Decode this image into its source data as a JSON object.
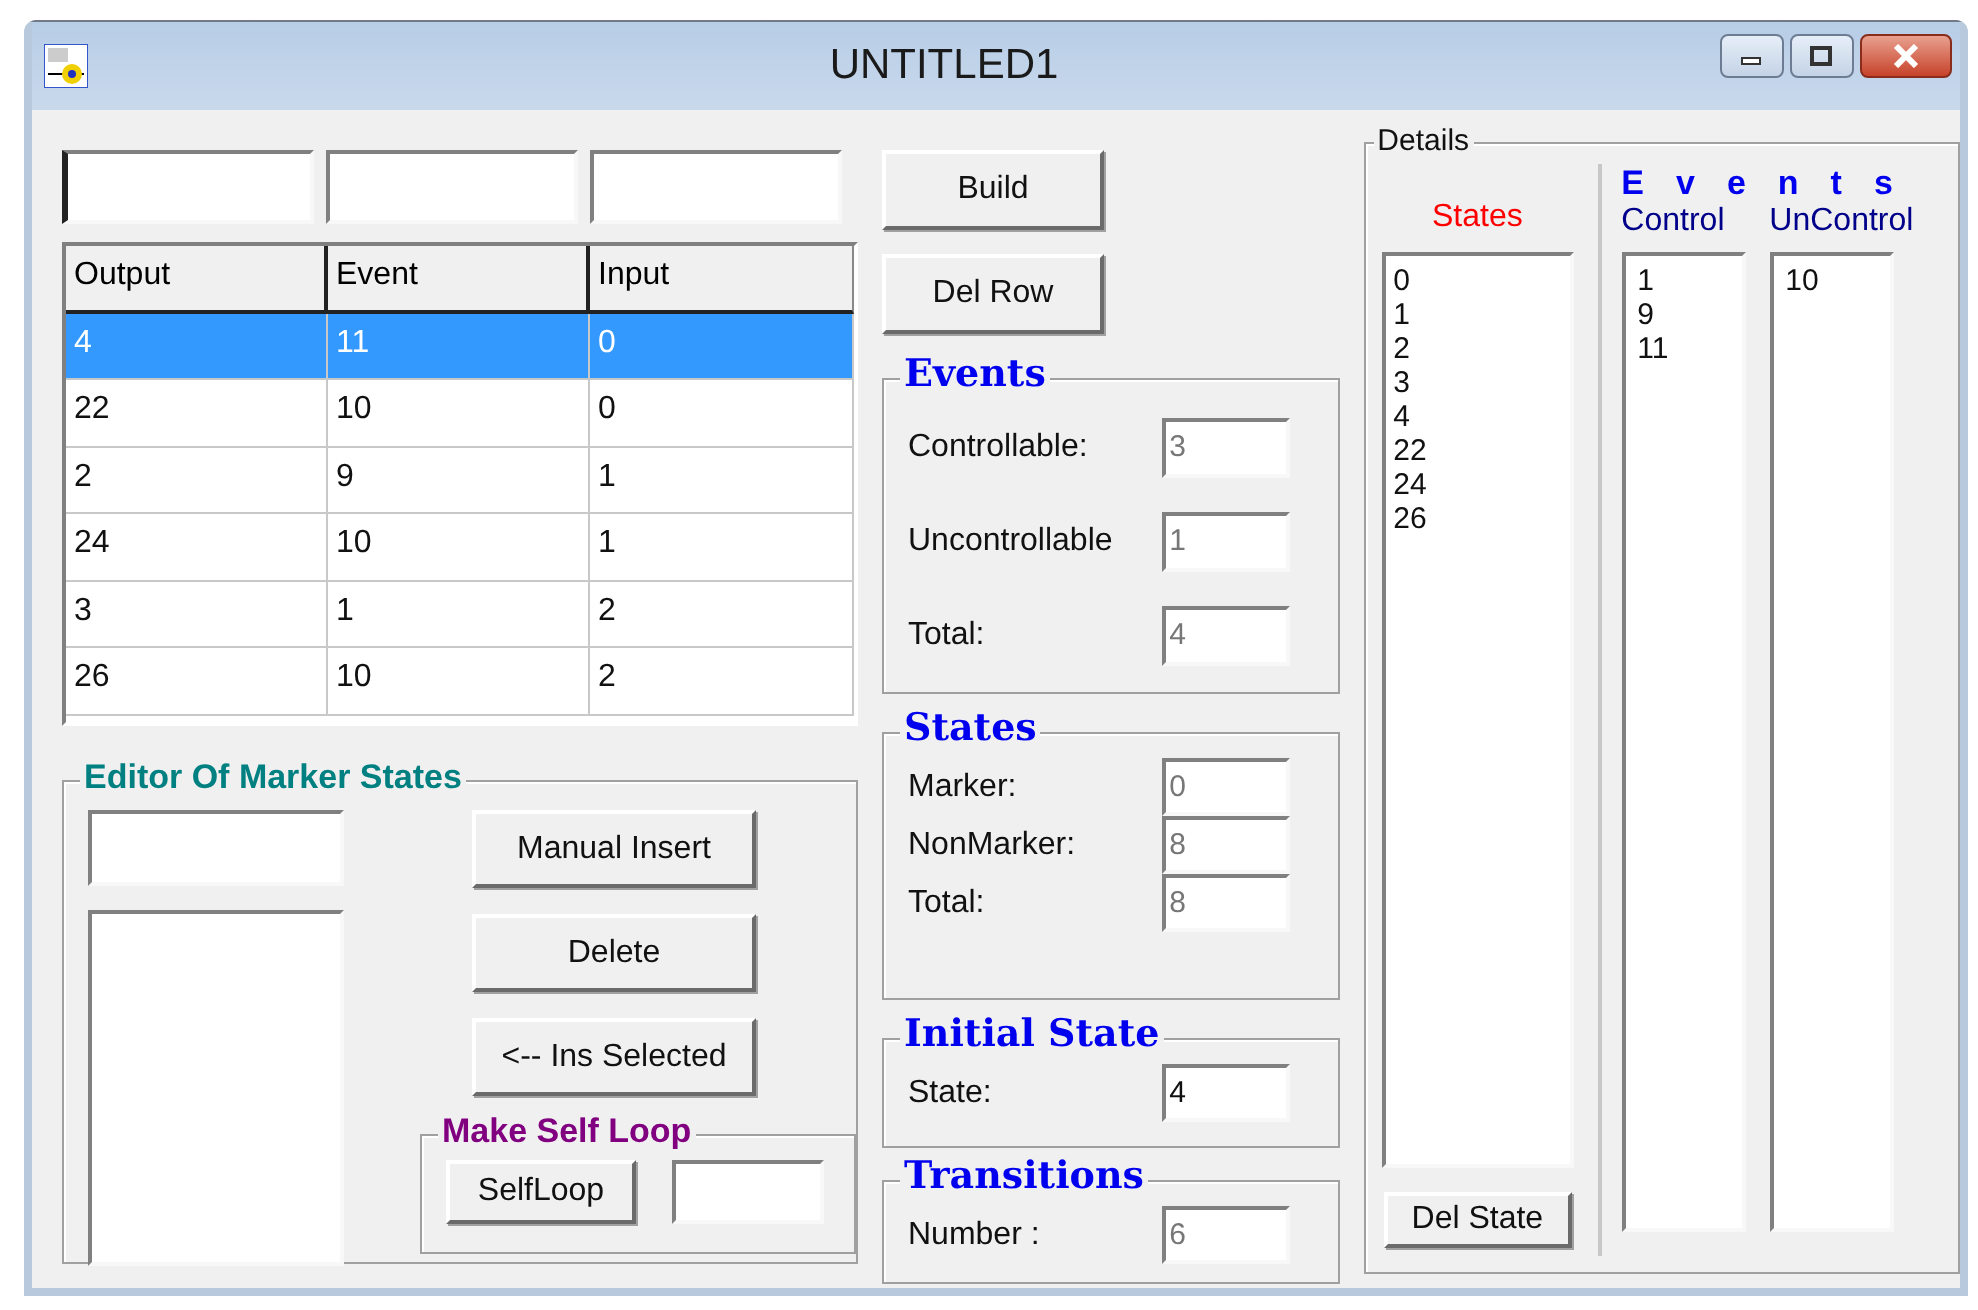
{
  "window": {
    "title": "UNTITLED1"
  },
  "table": {
    "columns": [
      "Output",
      "Event",
      "Input"
    ],
    "rows": [
      {
        "cells": [
          "4",
          "11",
          "0"
        ],
        "selected": true
      },
      {
        "cells": [
          "22",
          "10",
          "0"
        ],
        "selected": false
      },
      {
        "cells": [
          "2",
          "9",
          "1"
        ],
        "selected": false
      },
      {
        "cells": [
          "24",
          "10",
          "1"
        ],
        "selected": false
      },
      {
        "cells": [
          "3",
          "1",
          "2"
        ],
        "selected": false
      },
      {
        "cells": [
          "26",
          "10",
          "2"
        ],
        "selected": false
      }
    ]
  },
  "actions": [
    "Build",
    "Del Row"
  ],
  "groups": [
    {
      "title": "Events",
      "kind": "spaced",
      "fields": [
        {
          "label": "Controllable:",
          "value": "3",
          "disabled": true
        },
        {
          "label": "Uncontrollable",
          "value": "1",
          "disabled": true
        },
        {
          "label": "Total:",
          "value": "4",
          "disabled": true
        }
      ]
    },
    {
      "title": "States",
      "kind": "compact",
      "fields": [
        {
          "label": "Marker:",
          "value": "0",
          "disabled": true
        },
        {
          "label": "NonMarker:",
          "value": "8",
          "disabled": true
        },
        {
          "label": "Total:",
          "value": "8",
          "disabled": true
        }
      ]
    },
    {
      "title": "Initial State",
      "kind": "compact",
      "fields": [
        {
          "label": "State:",
          "value": "4",
          "disabled": false
        }
      ]
    },
    {
      "title": "Transitions",
      "kind": "compact",
      "fields": [
        {
          "label": "Number :",
          "value": "6",
          "disabled": true
        }
      ]
    }
  ],
  "marker_editor": {
    "title": "Editor Of Marker States",
    "buttons": [
      "Manual Insert",
      "Delete",
      "<-- Ins Selected"
    ],
    "self_loop": {
      "title": "Make Self Loop",
      "button": "SelfLoop"
    }
  },
  "details": {
    "title": "Details",
    "states_label": "States",
    "states": [
      "0",
      "1",
      "2",
      "3",
      "4",
      "22",
      "24",
      "26"
    ],
    "del_button": "Del State",
    "events_title": "Events",
    "control_label": "Control",
    "control": [
      "1",
      "9",
      "11"
    ],
    "uncontrol_label": "UnControl",
    "uncontrol": [
      "10"
    ]
  }
}
